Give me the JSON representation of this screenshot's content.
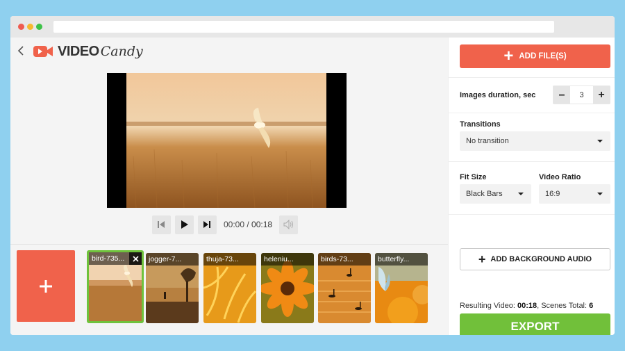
{
  "logo": {
    "word1": "VIDEO",
    "word2": "Candy"
  },
  "player": {
    "current_time": "00:00",
    "separator": " / ",
    "total_time": "00:18"
  },
  "timeline": {
    "thumbnails": [
      {
        "label": "bird-735...",
        "selected": true
      },
      {
        "label": "jogger-7...",
        "selected": false
      },
      {
        "label": "thuja-73...",
        "selected": false
      },
      {
        "label": "heleniu...",
        "selected": false
      },
      {
        "label": "birds-73...",
        "selected": false
      },
      {
        "label": "butterfly...",
        "selected": false
      }
    ]
  },
  "settings": {
    "add_files_label": "ADD FILE(S)",
    "images_duration_label": "Images duration, sec",
    "images_duration_value": "3",
    "transitions_label": "Transitions",
    "transitions_value": "No transition",
    "fit_size_label": "Fit Size",
    "fit_size_value": "Black Bars",
    "video_ratio_label": "Video Ratio",
    "video_ratio_value": "16:9",
    "bg_audio_label": "ADD BACKGROUND AUDIO",
    "summary_prefix": "Resulting Video: ",
    "summary_duration": "00:18",
    "summary_mid": ", Scenes Total: ",
    "summary_scenes": "6",
    "export_label": "EXPORT"
  },
  "colors": {
    "accent_red": "#f0624b",
    "export_green": "#71c03a",
    "selected_border": "#6fc23c",
    "background": "#8fd0ef"
  }
}
